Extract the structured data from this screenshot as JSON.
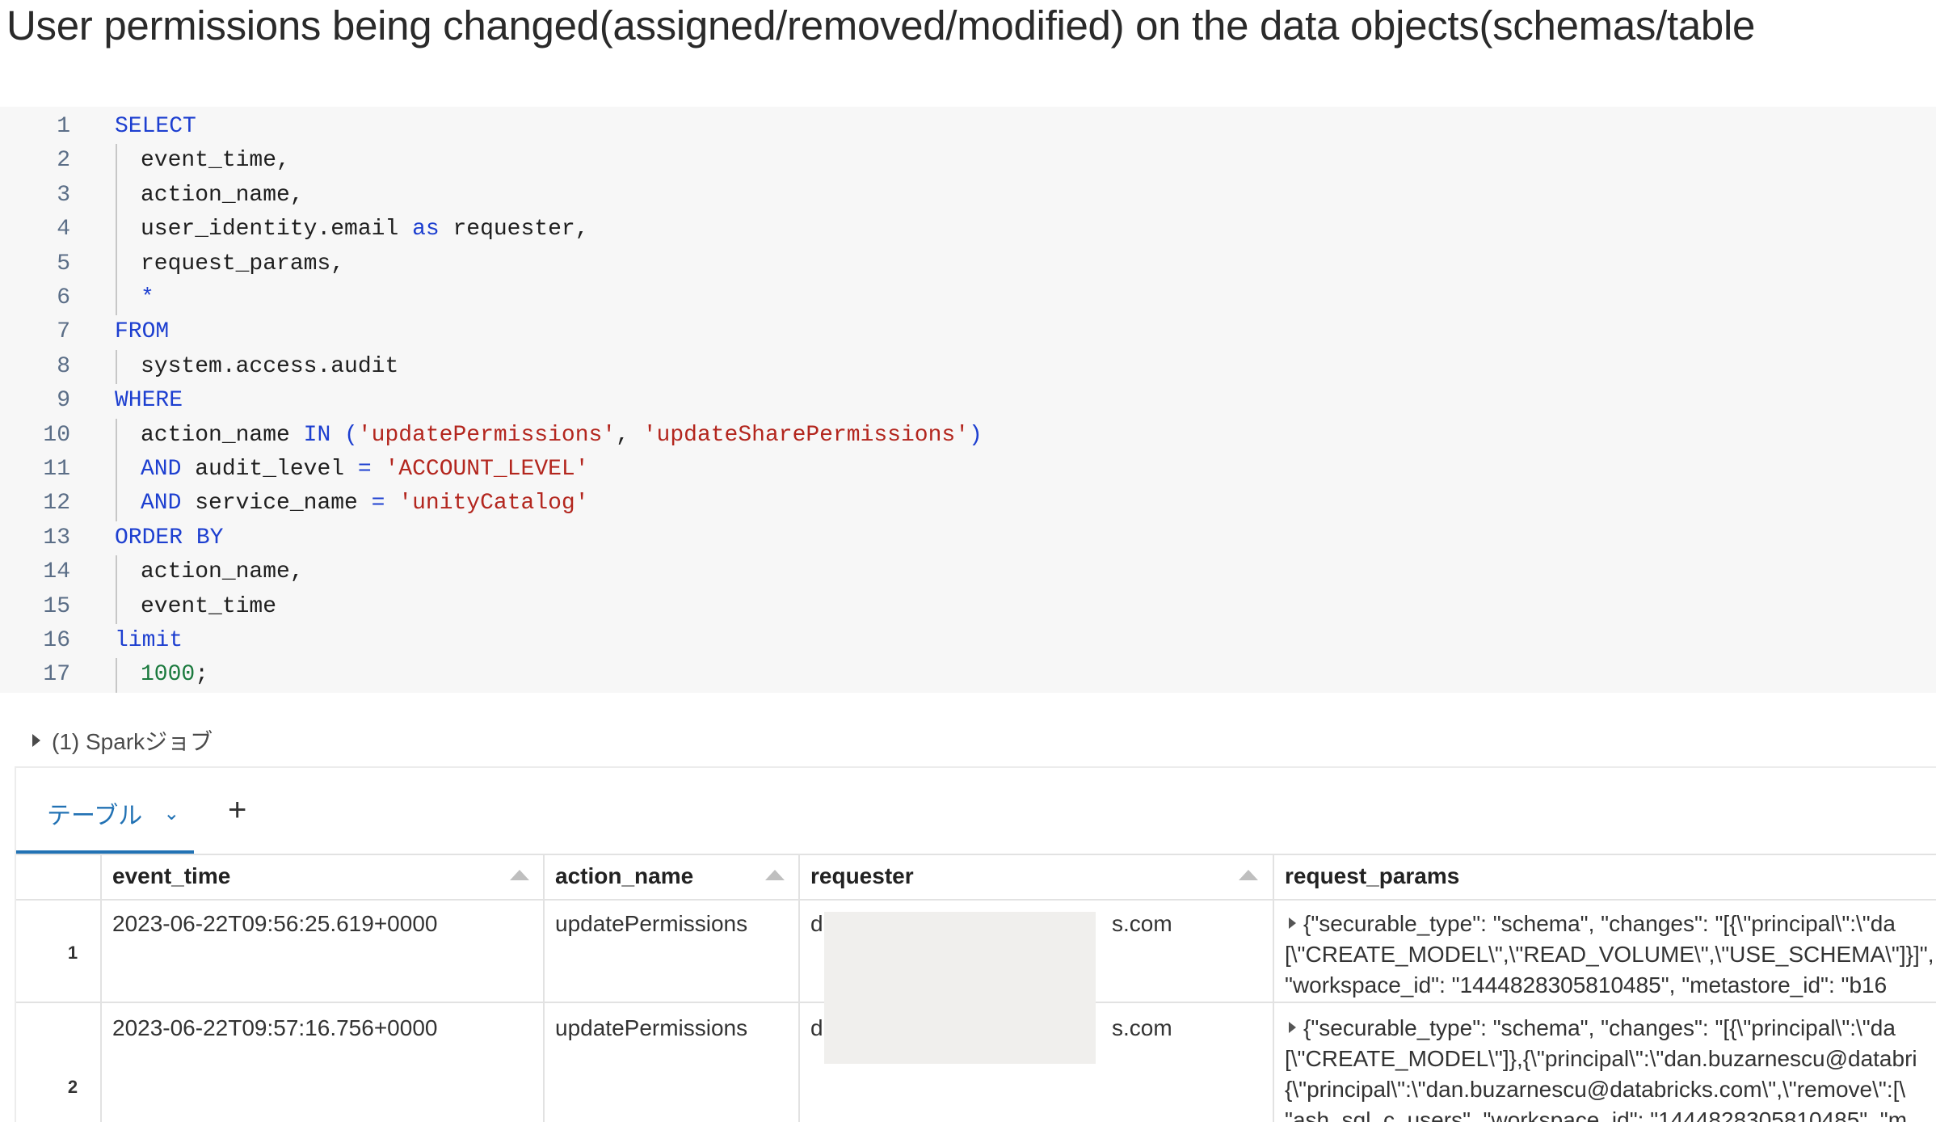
{
  "title": "User permissions being changed(assigned/removed/modified) on the data objects(schemas/table",
  "code": {
    "lines": [
      {
        "n": "1",
        "indent": false,
        "tokens": [
          {
            "c": "kw",
            "t": "SELECT"
          }
        ]
      },
      {
        "n": "2",
        "indent": true,
        "tokens": [
          {
            "c": "plain",
            "t": "event_time,"
          }
        ]
      },
      {
        "n": "3",
        "indent": true,
        "tokens": [
          {
            "c": "plain",
            "t": "action_name,"
          }
        ]
      },
      {
        "n": "4",
        "indent": true,
        "tokens": [
          {
            "c": "plain",
            "t": "user_identity.email "
          },
          {
            "c": "kw",
            "t": "as"
          },
          {
            "c": "plain",
            "t": " requester,"
          }
        ]
      },
      {
        "n": "5",
        "indent": true,
        "tokens": [
          {
            "c": "plain",
            "t": "request_params,"
          }
        ]
      },
      {
        "n": "6",
        "indent": true,
        "tokens": [
          {
            "c": "kw",
            "t": "*"
          }
        ]
      },
      {
        "n": "7",
        "indent": false,
        "tokens": [
          {
            "c": "kw",
            "t": "FROM"
          }
        ]
      },
      {
        "n": "8",
        "indent": true,
        "tokens": [
          {
            "c": "plain",
            "t": "system.access.audit"
          }
        ]
      },
      {
        "n": "9",
        "indent": false,
        "tokens": [
          {
            "c": "kw",
            "t": "WHERE"
          }
        ]
      },
      {
        "n": "10",
        "indent": true,
        "tokens": [
          {
            "c": "plain",
            "t": "action_name "
          },
          {
            "c": "kw",
            "t": "IN ("
          },
          {
            "c": "str",
            "t": "'updatePermissions'"
          },
          {
            "c": "plain",
            "t": ", "
          },
          {
            "c": "str",
            "t": "'updateSharePermissions'"
          },
          {
            "c": "kw",
            "t": ")"
          }
        ]
      },
      {
        "n": "11",
        "indent": true,
        "tokens": [
          {
            "c": "kw",
            "t": "AND"
          },
          {
            "c": "plain",
            "t": " audit_level "
          },
          {
            "c": "kw",
            "t": "="
          },
          {
            "c": "plain",
            "t": " "
          },
          {
            "c": "str",
            "t": "'ACCOUNT_LEVEL'"
          }
        ]
      },
      {
        "n": "12",
        "indent": true,
        "tokens": [
          {
            "c": "kw",
            "t": "AND"
          },
          {
            "c": "plain",
            "t": " service_name "
          },
          {
            "c": "kw",
            "t": "="
          },
          {
            "c": "plain",
            "t": " "
          },
          {
            "c": "str",
            "t": "'unityCatalog'"
          }
        ]
      },
      {
        "n": "13",
        "indent": false,
        "tokens": [
          {
            "c": "kw",
            "t": "ORDER BY"
          }
        ]
      },
      {
        "n": "14",
        "indent": true,
        "tokens": [
          {
            "c": "plain",
            "t": "action_name,"
          }
        ]
      },
      {
        "n": "15",
        "indent": true,
        "tokens": [
          {
            "c": "plain",
            "t": "event_time"
          }
        ]
      },
      {
        "n": "16",
        "indent": false,
        "tokens": [
          {
            "c": "kw",
            "t": "limit"
          }
        ]
      },
      {
        "n": "17",
        "indent": true,
        "tokens": [
          {
            "c": "num",
            "t": "1000"
          },
          {
            "c": "plain",
            "t": ";"
          }
        ]
      }
    ]
  },
  "spark_jobs": "(1) Sparkジョブ",
  "results": {
    "tab_label": "テーブル",
    "add_tab": "+",
    "columns": [
      "event_time",
      "action_name",
      "requester",
      "request_params"
    ],
    "rows": [
      {
        "num": "1",
        "event_time": "2023-06-22T09:56:25.619+0000",
        "action_name": "updatePermissions",
        "requester_prefix": "d",
        "requester_suffix": "s.com",
        "request_params": [
          "{\"securable_type\": \"schema\", \"changes\": \"[{\\\"principal\\\":\\\"da",
          "[\\\"CREATE_MODEL\\\",\\\"READ_VOLUME\\\",\\\"USE_SCHEMA\\\"]}]\", \"",
          "\"workspace_id\": \"1444828305810485\", \"metastore_id\": \"b16"
        ]
      },
      {
        "num": "2",
        "event_time": "2023-06-22T09:57:16.756+0000",
        "action_name": "updatePermissions",
        "requester_prefix": "d",
        "requester_suffix": "s.com",
        "request_params": [
          "{\"securable_type\": \"schema\", \"changes\": \"[{\\\"principal\\\":\\\"da",
          "[\\\"CREATE_MODEL\\\"]},{\\\"principal\\\":\\\"dan.buzarnescu@databri",
          "{\\\"principal\\\":\\\"dan.buzarnescu@databricks.com\\\",\\\"remove\\\":[\\",
          "\"ash_sql_c_users\", \"workspace_id\": \"1444828305810485\", \"m"
        ]
      }
    ]
  }
}
